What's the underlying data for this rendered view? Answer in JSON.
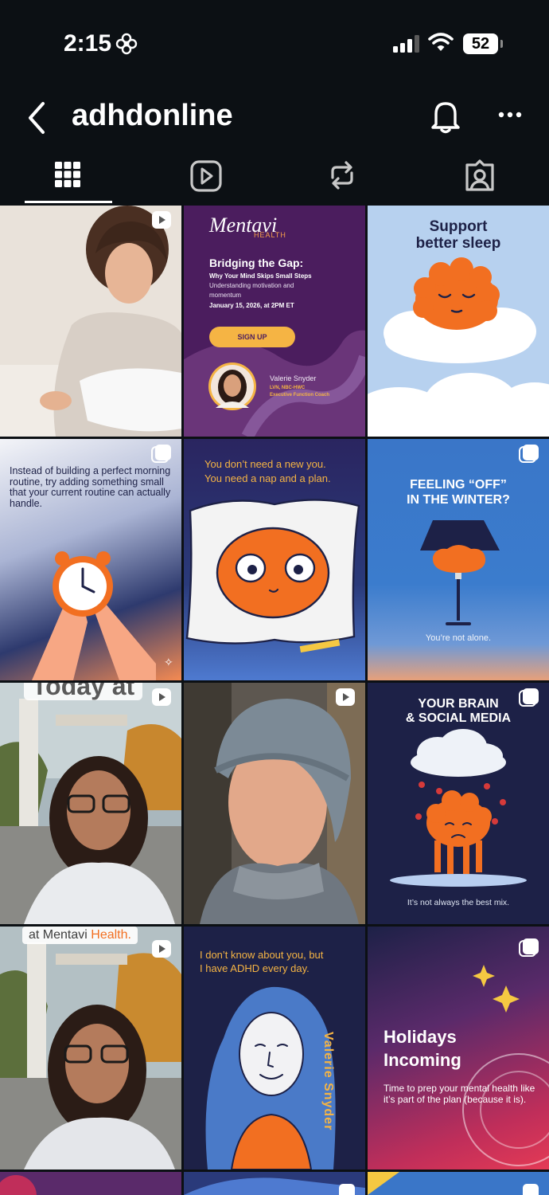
{
  "status": {
    "time": "2:15",
    "battery": "52"
  },
  "header": {
    "title": "adhdonline"
  },
  "posts": [
    {
      "id": "p1",
      "kind": "video"
    },
    {
      "id": "p2",
      "brand": "Mentavi",
      "brand_sub": "HEALTH",
      "heading": "Bridging the Gap:",
      "subheading": "Why Your Mind Skips Small Steps",
      "body": "Understanding motivation and momentum",
      "date": "January 15, 2026, at 2PM ET",
      "button": "SIGN UP",
      "speaker_name": "Valerie Snyder",
      "speaker_creds": "LVN, NBC-HWC",
      "speaker_role": "Executive Function Coach"
    },
    {
      "id": "p3",
      "title_line1": "Support",
      "title_line2": "better sleep"
    },
    {
      "id": "p4",
      "kind": "carousel",
      "text": "Instead of building a perfect morning routine, try adding something small that your current routine can actually handle."
    },
    {
      "id": "p5",
      "line1": "You don’t need a new you.",
      "line2": "You need a nap and a plan."
    },
    {
      "id": "p6",
      "kind": "carousel",
      "title_line1": "FEELING “OFF”",
      "title_line2": "IN THE WINTER?",
      "caption": "You’re not alone."
    },
    {
      "id": "p7",
      "kind": "video",
      "overlay": "Today at"
    },
    {
      "id": "p8",
      "kind": "video"
    },
    {
      "id": "p9",
      "kind": "carousel",
      "title_line1": "YOUR BRAIN",
      "title_line2": "& SOCIAL MEDIA",
      "caption": "It’s not always the best mix."
    },
    {
      "id": "p10",
      "kind": "video",
      "overlay_a": "at Mentavi ",
      "overlay_b": "Health."
    },
    {
      "id": "p11",
      "line1": "I don’t know about you, but",
      "line2": "I have ADHD every day.",
      "signature": "Valerie Snyder"
    },
    {
      "id": "p12",
      "kind": "carousel",
      "title_line1": "Holidays",
      "title_line2": "Incoming",
      "body": "Time to prep your mental health like it’s part of the plan (because it is)."
    }
  ],
  "colors": {
    "background": "#0c1014",
    "accent_orange": "#f26f21",
    "mentavi_purple": "#4b1d5e",
    "navy": "#1d2147",
    "sky": "#b7d1ef"
  }
}
